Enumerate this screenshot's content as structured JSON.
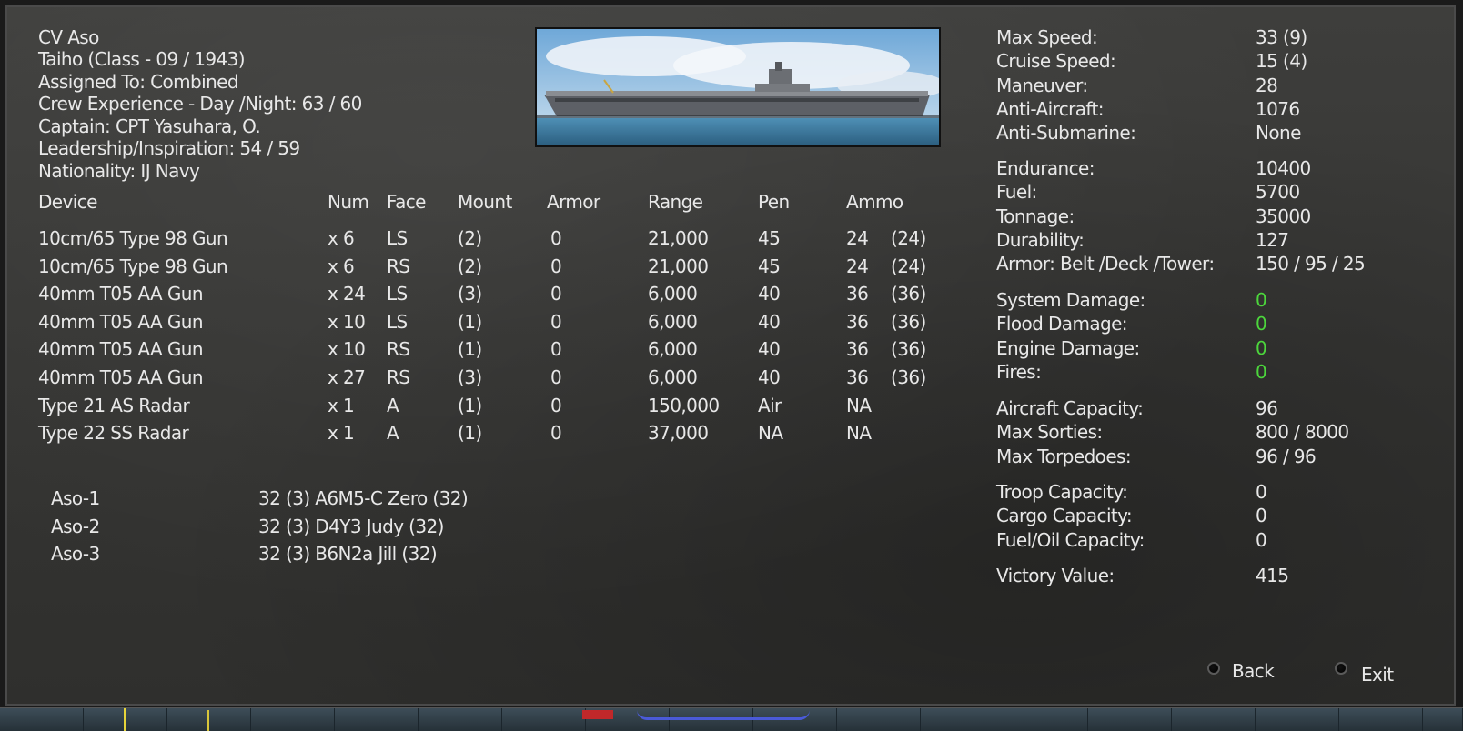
{
  "ship": {
    "name": "CV Aso",
    "class_line": "Taiho (Class - 09 / 1943)",
    "assigned_line": "Assigned To:    Combined",
    "crew_line": "Crew Experience - Day /Night:  63  /  60",
    "captain_line": "Captain:  CPT Yasuhara, O.",
    "leadership_line": "Leadership/Inspiration: 54 / 59",
    "nationality_line": "Nationality: IJ Navy"
  },
  "devices": {
    "headers": [
      "Device",
      "Num",
      "Face",
      "Mount",
      "Armor",
      "Range",
      "Pen",
      "Ammo"
    ],
    "rows": [
      {
        "device": "10cm/65 Type 98 Gun",
        "num": "x 6",
        "face": "LS",
        "mount": "(2)",
        "armor": "0",
        "range": "21,000",
        "pen": "45",
        "ammo": "24",
        "ammo_max": "(24)"
      },
      {
        "device": "10cm/65 Type 98 Gun",
        "num": "x 6",
        "face": "RS",
        "mount": "(2)",
        "armor": "0",
        "range": "21,000",
        "pen": "45",
        "ammo": "24",
        "ammo_max": "(24)"
      },
      {
        "device": "40mm T05 AA Gun",
        "num": "x 24",
        "face": "LS",
        "mount": "(3)",
        "armor": "0",
        "range": "6,000",
        "pen": "40",
        "ammo": "36",
        "ammo_max": "(36)"
      },
      {
        "device": "40mm T05 AA Gun",
        "num": "x 10",
        "face": "LS",
        "mount": "(1)",
        "armor": "0",
        "range": "6,000",
        "pen": "40",
        "ammo": "36",
        "ammo_max": "(36)"
      },
      {
        "device": "40mm T05 AA Gun",
        "num": "x 10",
        "face": "RS",
        "mount": "(1)",
        "armor": "0",
        "range": "6,000",
        "pen": "40",
        "ammo": "36",
        "ammo_max": "(36)"
      },
      {
        "device": "40mm T05 AA Gun",
        "num": "x 27",
        "face": "RS",
        "mount": "(3)",
        "armor": "0",
        "range": "6,000",
        "pen": "40",
        "ammo": "36",
        "ammo_max": "(36)"
      },
      {
        "device": "Type 21 AS Radar",
        "num": "x 1",
        "face": "A",
        "mount": "(1)",
        "armor": "0",
        "range": "150,000",
        "pen": "Air",
        "ammo": "NA",
        "ammo_max": ""
      },
      {
        "device": "Type 22 SS Radar",
        "num": "x 1",
        "face": "A",
        "mount": "(1)",
        "armor": "0",
        "range": "37,000",
        "pen": "NA",
        "ammo": "NA",
        "ammo_max": ""
      }
    ]
  },
  "air_groups": [
    {
      "name": "Aso-1",
      "detail": "32 (3) A6M5-C Zero (32)"
    },
    {
      "name": "Aso-2",
      "detail": "32 (3) D4Y3 Judy (32)"
    },
    {
      "name": "Aso-3",
      "detail": "32 (3) B6N2a Jill (32)"
    }
  ],
  "stats": {
    "group1": [
      {
        "label": "Max Speed:",
        "value": "33  (9)"
      },
      {
        "label": "Cruise Speed:",
        "value": "15  (4)"
      },
      {
        "label": "Maneuver:",
        "value": "28"
      },
      {
        "label": "Anti-Aircraft:",
        "value": "1076"
      },
      {
        "label": "Anti-Submarine:",
        "value": "None"
      }
    ],
    "group2": [
      {
        "label": "Endurance:",
        "value": "10400"
      },
      {
        "label": "Fuel:",
        "value": "5700"
      },
      {
        "label": "Tonnage:",
        "value": "35000"
      },
      {
        "label": "Durability:",
        "value": "127"
      },
      {
        "label": "Armor: Belt /Deck /Tower:",
        "value": "150 / 95 / 25"
      }
    ],
    "group3": [
      {
        "label": "System Damage:",
        "value": "0"
      },
      {
        "label": "Flood Damage:",
        "value": "0"
      },
      {
        "label": "Engine Damage:",
        "value": "0"
      },
      {
        "label": "Fires:",
        "value": "0"
      }
    ],
    "group4": [
      {
        "label": "Aircraft Capacity:",
        "value": "96"
      },
      {
        "label": "Max Sorties:",
        "value": "800 / 8000"
      },
      {
        "label": "Max Torpedoes:",
        "value": "96 / 96"
      }
    ],
    "group5": [
      {
        "label": "Troop Capacity:",
        "value": "0"
      },
      {
        "label": "Cargo Capacity:",
        "value": "0"
      },
      {
        "label": "Fuel/Oil Capacity:",
        "value": "0"
      }
    ],
    "group6": [
      {
        "label": "Victory Value:",
        "value": "415"
      }
    ]
  },
  "buttons": {
    "back": "Back",
    "exit": "Exit"
  },
  "colors": {
    "damage_ok": "#4cd63c",
    "text": "#e8e8e8",
    "panel_bg": "#3a3a38"
  }
}
